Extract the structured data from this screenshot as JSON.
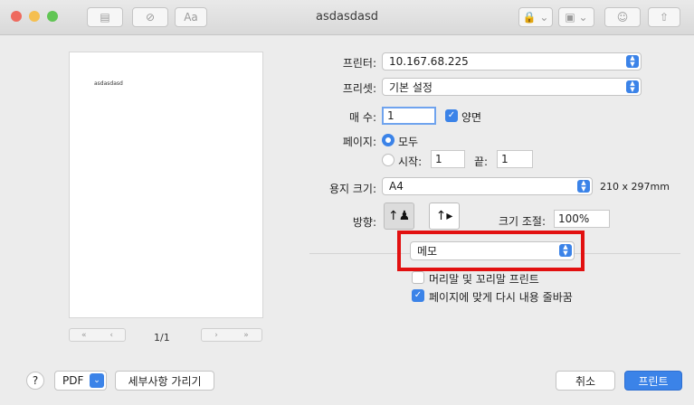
{
  "window": {
    "title": "asdasdasd",
    "colors": {
      "close": "#ee6a5e",
      "minimize": "#f5bf4f",
      "zoom": "#61c554",
      "accent": "#3b83e8",
      "highlight": "#e21010"
    }
  },
  "toolbar": {
    "sidebar_icon": "▤",
    "check_icon": "⊘",
    "font_label": "Aa",
    "lock_icon": "🔒",
    "image_icon": "▣",
    "people_icon": "☺",
    "share_icon": "⇧"
  },
  "preview": {
    "document_text": "asdasdasd",
    "page_indicator": "1/1",
    "first_page": "«",
    "prev_page": "‹",
    "next_page": "›",
    "last_page": "»"
  },
  "form": {
    "printer_label": "프린터:",
    "printer_value": "10.167.68.225",
    "preset_label": "프리셋:",
    "preset_value": "기본 설정",
    "copies_label": "매 수:",
    "copies_value": "1",
    "duplex_label": "양면",
    "pages_label": "페이지:",
    "pages_all": "모두",
    "from_label": "시작:",
    "from_value": "1",
    "to_label": "끝:",
    "to_value": "1",
    "paper_size_label": "용지 크기:",
    "paper_size_value": "A4",
    "paper_dims": "210 x 297mm",
    "orientation_label": "방향:",
    "scale_label": "크기 조절:",
    "scale_value": "100%",
    "section_value": "메모",
    "header_footer_label": "머리말 및 꼬리말 프린트",
    "rewrap_label": "페이지에 맞게 다시 내용 줄바꿈"
  },
  "footer": {
    "help_label": "?",
    "pdf_label": "PDF",
    "details_label": "세부사항 가리기",
    "cancel_label": "취소",
    "print_label": "프린트"
  }
}
